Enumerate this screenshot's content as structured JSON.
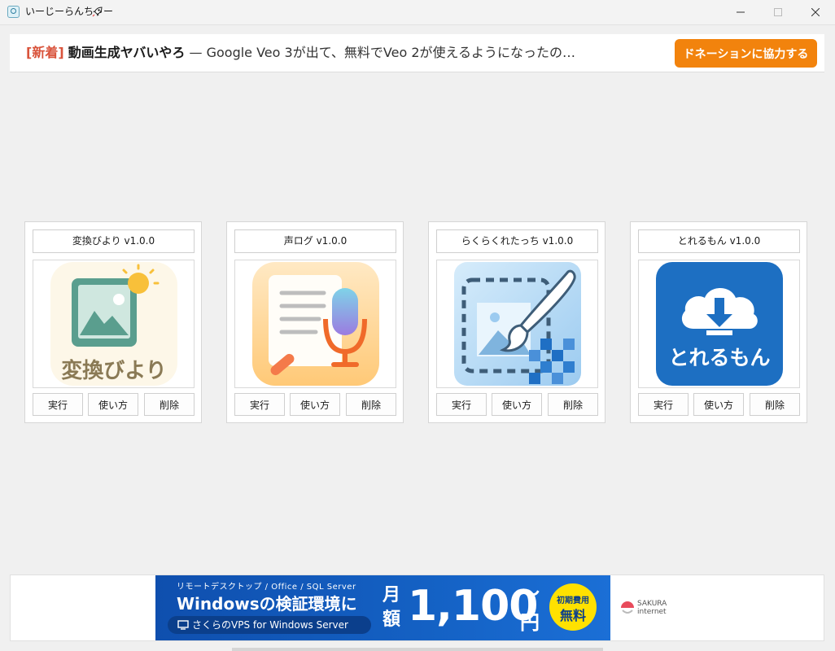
{
  "window": {
    "title": "いーじーらんちゃー"
  },
  "news": {
    "tag": "[新着]",
    "headline": "動画生成ヤバいやろ",
    "description": " — Google Veo 3が出て、無料でVeo 2が使えるようになったの…",
    "donate_label": "ドネーションに協力する"
  },
  "apps": [
    {
      "title": "変換びより v1.0.0",
      "icon": "henkan-biyori-icon",
      "icon_text": "変換びより",
      "run": "実行",
      "howto": "使い方",
      "delete": "削除"
    },
    {
      "title": "声ログ v1.0.0",
      "icon": "koe-log-icon",
      "run": "実行",
      "howto": "使い方",
      "delete": "削除"
    },
    {
      "title": "らくらくれたっち v1.0.0",
      "icon": "rakuraku-retouch-icon",
      "run": "実行",
      "howto": "使い方",
      "delete": "削除"
    },
    {
      "title": "とれるもん v1.0.0",
      "icon": "torerumon-icon",
      "icon_text": "とれるもん",
      "run": "実行",
      "howto": "使い方",
      "delete": "削除"
    }
  ],
  "ad": {
    "line1": "リモートデスクトップ / Office / SQL Server",
    "line2": "Windowsの検証環境に",
    "pill": "さくらのVPS for Windows Server",
    "month": "月額",
    "price": "1,100",
    "tilde": "〜",
    "yen": "円",
    "badge_top": "初期費用",
    "badge_bottom": "無料",
    "sponsor_line1": "SAKURA",
    "sponsor_line2": "internet"
  },
  "colors": {
    "accent": "#f2830d",
    "news_tag": "#d9533b",
    "ad_blue": "#1461c4",
    "badge_yellow": "#ffe100"
  }
}
